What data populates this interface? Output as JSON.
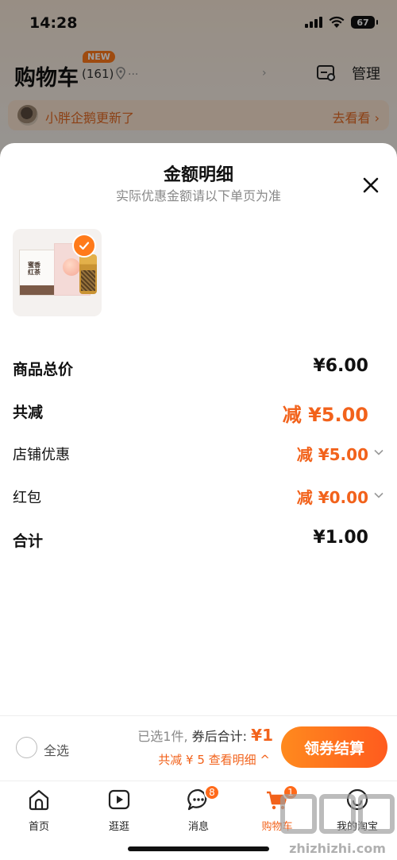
{
  "status_bar": {
    "time": "14:28",
    "battery": "67"
  },
  "cart_header": {
    "title": "购物车",
    "new_badge": "NEW",
    "count": "(161)",
    "location": "...",
    "manage_label": "管理"
  },
  "notice": {
    "text": "小胖企鹅更新了",
    "link": "去看看 ›"
  },
  "sheet": {
    "title": "金额明细",
    "subtitle": "实际优惠金额请以下单页为准",
    "rows": [
      {
        "label": "商品总价",
        "value": "¥6.00"
      },
      {
        "label": "共减",
        "value": "减 ¥5.00"
      },
      {
        "label": "店铺优惠",
        "value": "减 ¥5.00"
      },
      {
        "label": "红包",
        "value": "减 ¥0.00"
      },
      {
        "label": "合计",
        "value": "¥1.00"
      }
    ]
  },
  "checkout": {
    "select_all": "全选",
    "selected_text": "已选1件,",
    "after_coupon_label": "券后合计:",
    "total": "¥1",
    "discount_text": "共减 ¥ 5  查看明细 ^",
    "button": "领券结算"
  },
  "tabs": [
    {
      "label": "首页",
      "icon": "home-icon"
    },
    {
      "label": "逛逛",
      "icon": "play-icon"
    },
    {
      "label": "消息",
      "icon": "message-icon",
      "badge": "8"
    },
    {
      "label": "购物车",
      "icon": "cart-icon",
      "badge": "1",
      "active": true
    },
    {
      "label": "我的淘宝",
      "icon": "profile-icon"
    }
  ],
  "watermark": {
    "text": "zhizhizhi.com"
  },
  "colors": {
    "accent": "#f2621b",
    "button_start": "#ff8a1e",
    "button_end": "#ff5b1e"
  }
}
